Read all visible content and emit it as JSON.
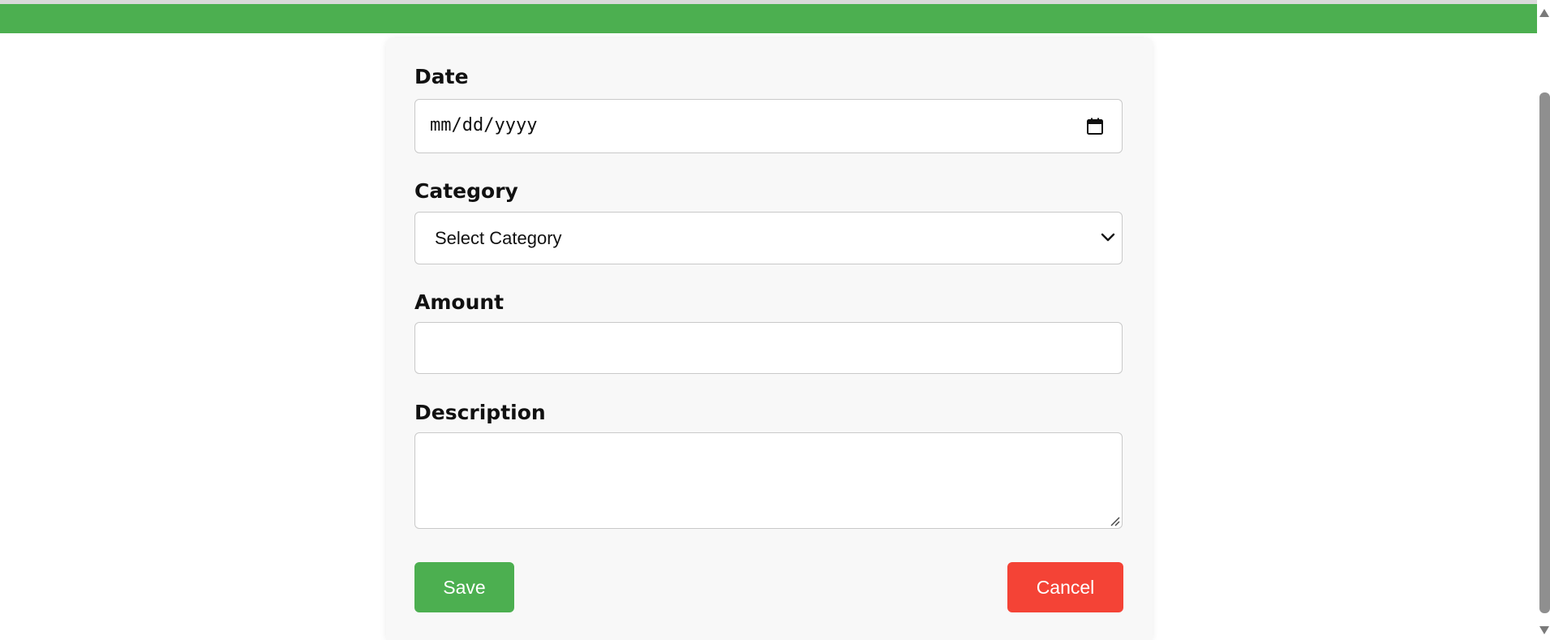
{
  "form": {
    "date": {
      "label": "Date",
      "placeholder": "mm/dd/yyyy",
      "icon": "calendar-icon"
    },
    "category": {
      "label": "Category",
      "selected": "Select Category",
      "icon": "chevron-down-icon"
    },
    "amount": {
      "label": "Amount",
      "value": ""
    },
    "description": {
      "label": "Description",
      "value": ""
    },
    "buttons": {
      "save_label": "Save",
      "cancel_label": "Cancel"
    }
  },
  "colors": {
    "header": "#4caf50",
    "save": "#4caf50",
    "cancel": "#f44336",
    "card": "#f8f8f8"
  }
}
